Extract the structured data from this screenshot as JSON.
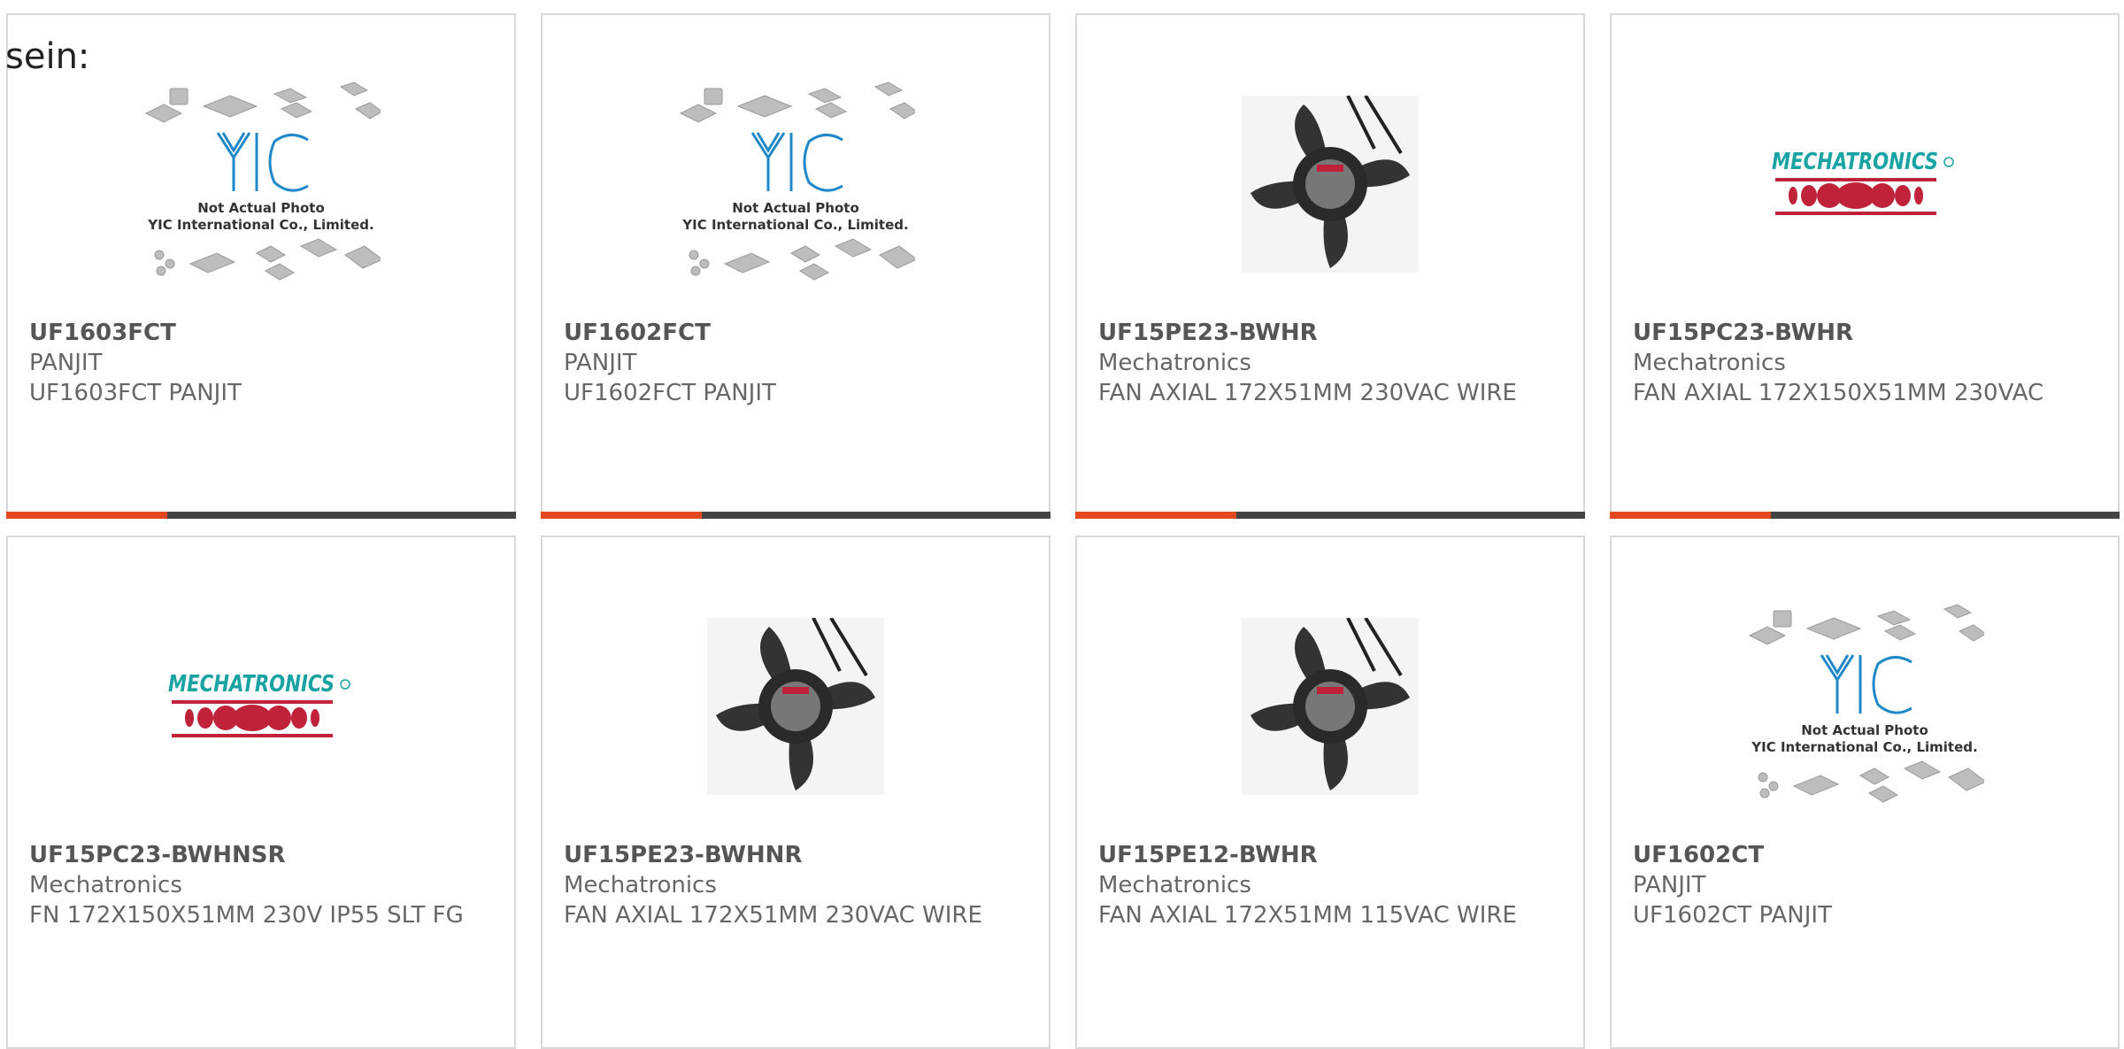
{
  "intro_text": "sein:",
  "placeholder_photo": {
    "line1": "Not Actual Photo",
    "line2": "YIC International Co., Limited."
  },
  "brand_logo": {
    "text": "MECHATRONICS"
  },
  "colors": {
    "accent": "#e2471e",
    "bar_dark": "#444444",
    "card_border": "#d8d8d8",
    "yic_blue": "#1e88c8",
    "mechatronics_teal": "#1aa3a3",
    "mechatronics_red": "#c0223a"
  },
  "products": [
    {
      "part": "UF1603FCT",
      "manufacturer": "PANJIT",
      "description": "UF1603FCT PANJIT",
      "image": "placeholder"
    },
    {
      "part": "UF1602FCT",
      "manufacturer": "PANJIT",
      "description": "UF1602FCT PANJIT",
      "image": "placeholder"
    },
    {
      "part": "UF15PE23-BWHR",
      "manufacturer": "Mechatronics",
      "description": "FAN AXIAL 172X51MM 230VAC WIRE",
      "image": "fan"
    },
    {
      "part": "UF15PC23-BWHR",
      "manufacturer": "Mechatronics",
      "description": "FAN AXIAL 172X150X51MM 230VAC",
      "image": "logo"
    },
    {
      "part": "UF15PC23-BWHNSR",
      "manufacturer": "Mechatronics",
      "description": "FN 172X150X51MM 230V IP55 SLT FG",
      "image": "logo"
    },
    {
      "part": "UF15PE23-BWHNR",
      "manufacturer": "Mechatronics",
      "description": "FAN AXIAL 172X51MM 230VAC WIRE",
      "image": "fan"
    },
    {
      "part": "UF15PE12-BWHR",
      "manufacturer": "Mechatronics",
      "description": "FAN AXIAL 172X51MM 115VAC WIRE",
      "image": "fan"
    },
    {
      "part": "UF1602CT",
      "manufacturer": "PANJIT",
      "description": "UF1602CT PANJIT",
      "image": "placeholder"
    }
  ]
}
